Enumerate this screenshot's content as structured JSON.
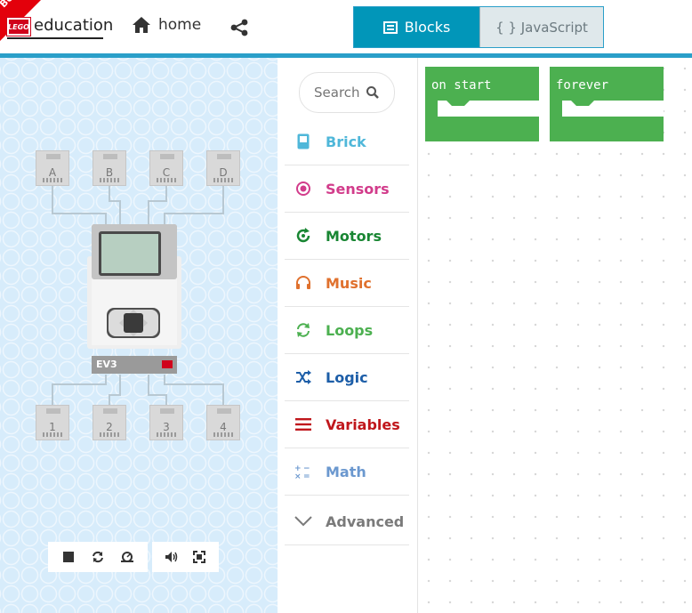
{
  "header": {
    "beta_label": "Beta",
    "lego_logo": "LEGO",
    "education_label": "education",
    "home_label": "home",
    "share_icon": "share-icon",
    "tabs": {
      "blocks_label": "Blocks",
      "javascript_label": "{ } JavaScript"
    }
  },
  "colors": {
    "accent": "#0196b9",
    "simulator_bg": "#d7ecfb",
    "block_green": "#4cb050"
  },
  "simulator": {
    "input_ports": [
      "A",
      "B",
      "C",
      "D"
    ],
    "output_ports": [
      "1",
      "2",
      "3",
      "4"
    ],
    "brick_label": "EV3",
    "tools": [
      "stop-icon",
      "restart-icon",
      "slow-motion-icon",
      "sound-icon",
      "fullscreen-icon"
    ]
  },
  "toolbox": {
    "search_placeholder": "Search",
    "categories": [
      {
        "label": "Brick",
        "color": "#4fb7d9",
        "icon": "brick-icon"
      },
      {
        "label": "Sensors",
        "color": "#d23c8b",
        "icon": "sensors-icon"
      },
      {
        "label": "Motors",
        "color": "#198633",
        "icon": "motors-icon"
      },
      {
        "label": "Music",
        "color": "#e0712e",
        "icon": "music-icon"
      },
      {
        "label": "Loops",
        "color": "#4cb050",
        "icon": "loops-icon"
      },
      {
        "label": "Logic",
        "color": "#1d5ea8",
        "icon": "logic-icon"
      },
      {
        "label": "Variables",
        "color": "#c0171c",
        "icon": "variables-icon"
      },
      {
        "label": "Math",
        "color": "#6b98cf",
        "icon": "math-icon"
      },
      {
        "label": "Advanced",
        "color": "#7a7a7a",
        "icon": "chevron-down-icon"
      }
    ]
  },
  "workspace": {
    "blocks": [
      {
        "label": "on start"
      },
      {
        "label": "forever"
      }
    ]
  }
}
